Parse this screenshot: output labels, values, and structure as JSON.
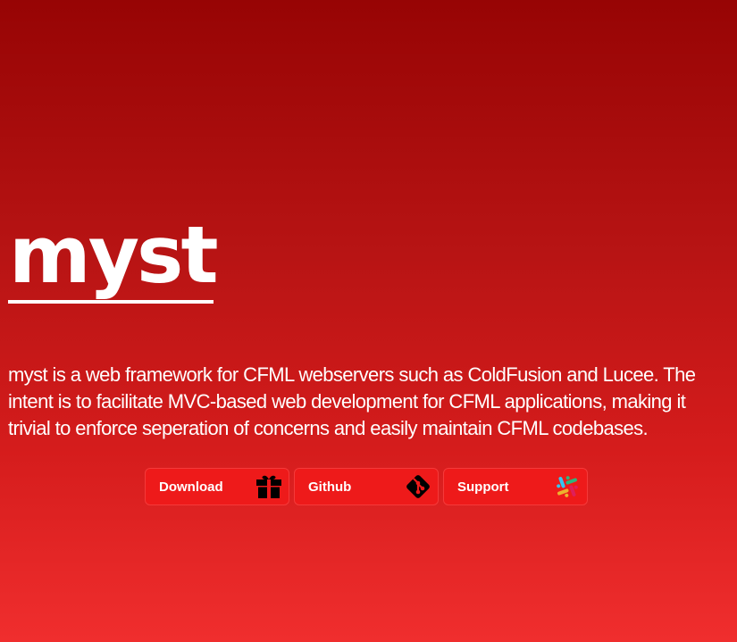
{
  "brand": {
    "logo_text": "myst"
  },
  "intro": {
    "text": "myst is a web framework for CFML webservers such as ColdFusion and Lucee. The intent is to facilitate MVC-based web development for CFML applications, making it trivial to enforce seperation of concerns and easily maintain CFML codebases."
  },
  "actions": {
    "download": {
      "label": "Download",
      "icon": "gift-box-icon"
    },
    "github": {
      "label": "Github",
      "icon": "git-icon"
    },
    "support": {
      "label": "Support",
      "icon": "slack-icon"
    }
  },
  "colors": {
    "background_top": "#970404",
    "background_bottom": "#f02e2e",
    "button_bg": "#ee1a1a",
    "button_border": "#f53a3a",
    "text": "#ffffff"
  }
}
